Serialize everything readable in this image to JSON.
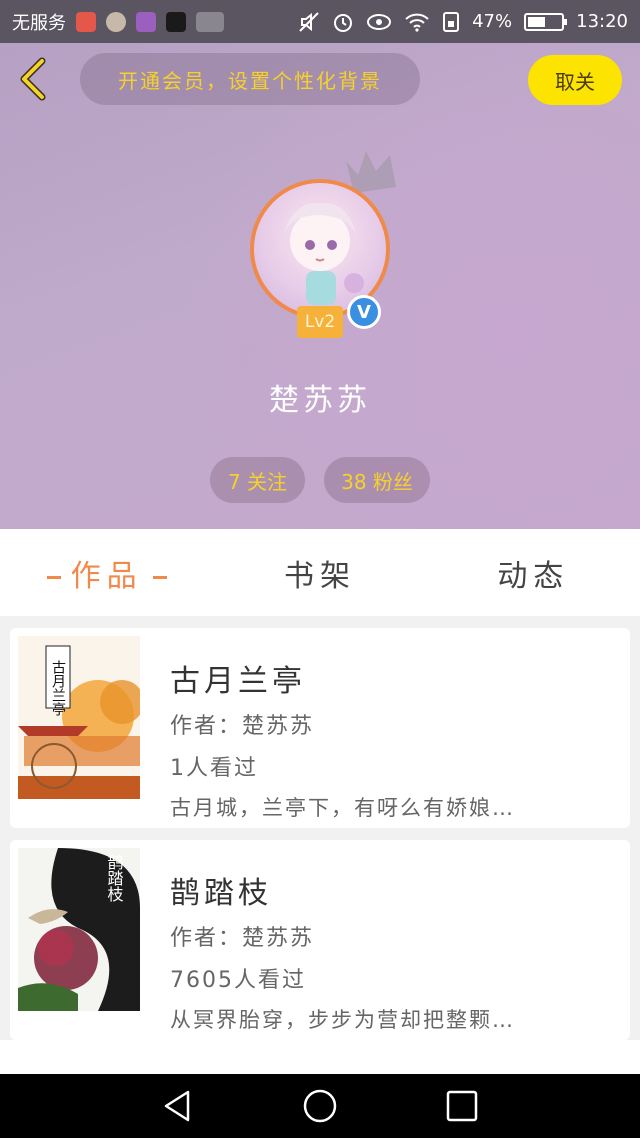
{
  "status_bar": {
    "carrier": "无服务",
    "battery": "47%",
    "battery_level": 0.47,
    "time": "13:20",
    "icons": [
      "mute-icon",
      "alarm-icon",
      "eye-icon",
      "wifi-icon",
      "sim-icon",
      "battery-icon"
    ]
  },
  "header": {
    "member_prompt": "开通会员，设置个性化背景",
    "cancel_label": "取关",
    "level": "Lv2",
    "verified": "V",
    "username": "楚苏苏",
    "following": "7 关注",
    "fans": "38 粉丝"
  },
  "tabs": [
    {
      "label": "作品",
      "active": true
    },
    {
      "label": "书架",
      "active": false
    },
    {
      "label": "动态",
      "active": false
    }
  ],
  "books": [
    {
      "title": "古月兰亭",
      "author": "作者：楚苏苏",
      "views": "1人看过",
      "description": "古月城，兰亭下，有呀么有娇娘…",
      "cover_text": "古月兰亭"
    },
    {
      "title": "鹊踏枝",
      "author": "作者：楚苏苏",
      "views": "7605人看过",
      "description": "从冥界胎穿，步步为营却把整颗…",
      "cover_text": "鹊踏枝"
    }
  ],
  "colors": {
    "accent": "#f08a4b",
    "gold": "#f6d12b",
    "cancel_bg": "#fce300",
    "verified": "#3b8fe0"
  }
}
